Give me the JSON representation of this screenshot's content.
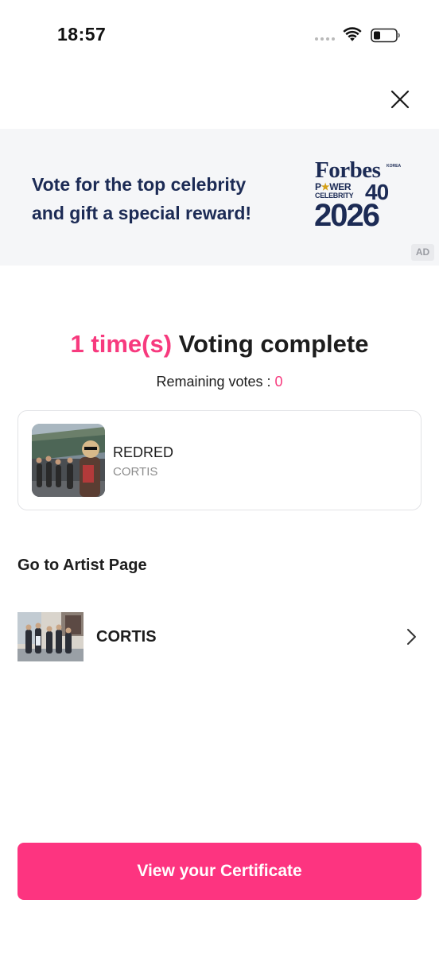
{
  "status_bar": {
    "time": "18:57",
    "icons": [
      "signal-dots-icon",
      "wifi-icon",
      "battery-icon"
    ]
  },
  "close": {
    "icon": "close-icon"
  },
  "ad": {
    "line1": "Vote for the top celebrity",
    "line2": "and gift a special reward!",
    "logo": {
      "brand": "Forbes",
      "region": "KOREA",
      "power_pre": "P",
      "power_post": "WER",
      "celebrity": "CELEBRITY",
      "number": "40",
      "year": "2026"
    },
    "badge": "AD",
    "background_color": "#f5f6f8",
    "text_color": "#1c2b55"
  },
  "result": {
    "count_text": "1 time(s)",
    "complete_text": "Voting complete",
    "remaining_label": "Remaining votes : ",
    "remaining_value": "0",
    "accent_color": "#f73a7e"
  },
  "voted_item": {
    "title": "REDRED",
    "artist": "CORTIS",
    "thumbnail": "group-photo"
  },
  "artist_section": {
    "title": "Go to Artist Page",
    "artists": [
      {
        "name": "CORTIS",
        "thumbnail": "group-photo",
        "icon": "chevron-right-icon"
      }
    ]
  },
  "certificate_button": {
    "label": "View your Certificate",
    "color": "#fd3480"
  }
}
